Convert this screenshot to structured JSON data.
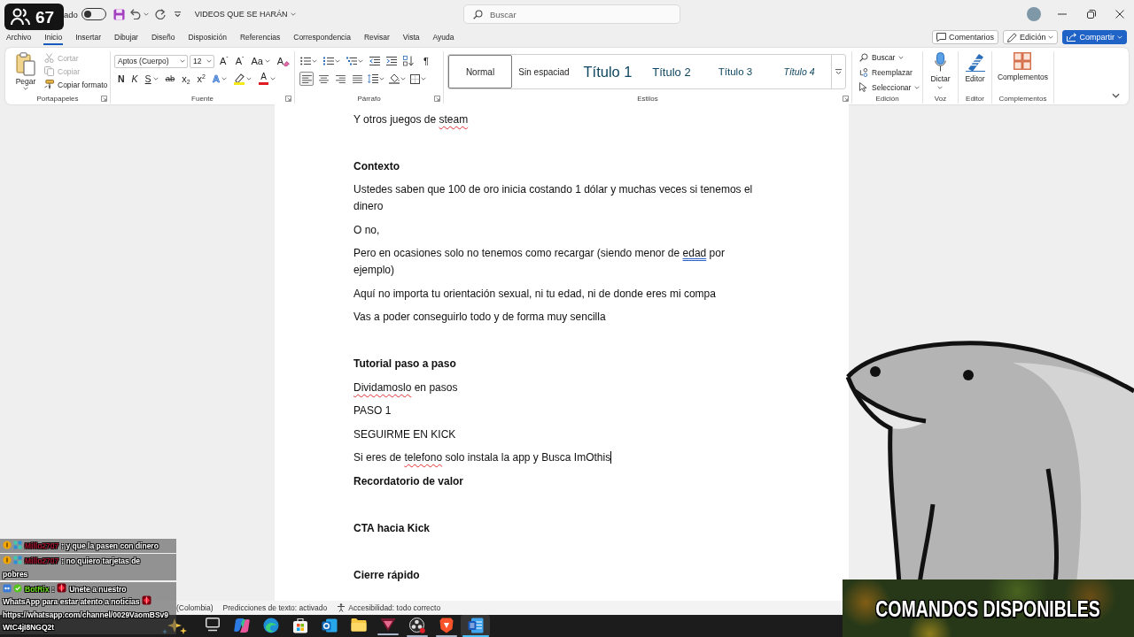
{
  "stream_overlay": {
    "viewer_count": "67"
  },
  "title_bar": {
    "autosave_label": "ado",
    "autosave_on": false,
    "document_title": "VIDEOS QUE SE HARÁN",
    "search": {
      "placeholder": "Buscar"
    }
  },
  "menu_tabs": [
    {
      "label": "Archivo",
      "selected": false
    },
    {
      "label": "Inicio",
      "selected": true
    },
    {
      "label": "Insertar",
      "selected": false
    },
    {
      "label": "Dibujar",
      "selected": false
    },
    {
      "label": "Diseño",
      "selected": false
    },
    {
      "label": "Disposición",
      "selected": false
    },
    {
      "label": "Referencias",
      "selected": false
    },
    {
      "label": "Correspondencia",
      "selected": false
    },
    {
      "label": "Revisar",
      "selected": false
    },
    {
      "label": "Vista",
      "selected": false
    },
    {
      "label": "Ayuda",
      "selected": false
    }
  ],
  "header_buttons": [
    {
      "kind": "comments",
      "label": "Comentarios"
    },
    {
      "kind": "mode",
      "label": "Edición"
    },
    {
      "kind": "share",
      "label": "Compartir"
    }
  ],
  "ribbon": {
    "clipboard": {
      "label": "Portapapeles",
      "paste": "Pegar",
      "items": [
        {
          "kind": "cut",
          "label": "Cortar",
          "disabled": true
        },
        {
          "kind": "copy",
          "label": "Copiar",
          "disabled": true
        },
        {
          "kind": "format_painter",
          "label": "Copiar formato",
          "disabled": false
        }
      ]
    },
    "font": {
      "label": "Fuente",
      "font_name": "Aptos (Cuerpo)",
      "font_size": "12",
      "row_1": [
        {
          "kind": "grow",
          "label": "A$^{ˆ}$"
        },
        {
          "kind": "shrink",
          "label": "A$^{ˇ}$"
        },
        {
          "kind": "case",
          "label": "Aa"
        },
        {
          "kind": "clear",
          "label": "A"
        }
      ],
      "row_2": [
        {
          "kind": "bold",
          "label": "N"
        },
        {
          "kind": "italic",
          "label": "K"
        },
        {
          "kind": "underline",
          "label": "S"
        },
        {
          "kind": "strike",
          "label": "ab"
        },
        {
          "kind": "subscript",
          "label": "x$_{2}$"
        },
        {
          "kind": "superscript",
          "label": "x$^{2}$"
        },
        {
          "kind": "effects",
          "label": "A"
        },
        {
          "kind": "highlight"
        },
        {
          "kind": "color",
          "label": "A"
        }
      ]
    },
    "paragraph": {
      "label": "Párrafo",
      "marks": "¶",
      "alignment": [
        {
          "selected": true
        },
        {
          "selected": false
        },
        {
          "selected": false
        },
        {
          "selected": false
        }
      ]
    },
    "styles": {
      "label": "Estilos",
      "items": [
        {
          "kind": "body",
          "label": "Normal",
          "selected": true
        },
        {
          "kind": "body",
          "label": "Sin espaciad",
          "selected": false
        },
        {
          "kind": "heading_1",
          "label": "Título 1",
          "selected": false
        },
        {
          "kind": "heading_2",
          "label": "Título 2",
          "selected": false
        },
        {
          "kind": "heading_3",
          "label": "Título 3",
          "selected": false
        },
        {
          "kind": "heading_4",
          "label": "Título 4",
          "selected": false
        }
      ]
    },
    "editing": {
      "label": "Edición",
      "items": [
        {
          "kind": "find",
          "label": "Buscar"
        },
        {
          "kind": "replace",
          "label": "Reemplazar"
        },
        {
          "kind": "select",
          "label": "Seleccionar"
        }
      ]
    },
    "voice": {
      "label": "Voz",
      "button": "Dictar"
    },
    "editor": {
      "label": "Editor",
      "button": "Editor"
    },
    "addins": {
      "label": "Complementos",
      "button": "Complementos"
    }
  },
  "document": {
    "paragraphs": [
      {
        "kind": "body",
        "cursor": false,
        "runs": [
          {
            "kind": "plain",
            "text": "Y otros juegos de "
          },
          {
            "kind": "spelling",
            "text": "steam"
          }
        ]
      },
      {
        "kind": "blank"
      },
      {
        "kind": "heading",
        "cursor": false,
        "runs": [
          {
            "kind": "plain",
            "text": "Contexto"
          }
        ]
      },
      {
        "kind": "body",
        "cursor": false,
        "runs": [
          {
            "kind": "plain",
            "text": "Ustedes saben que 100 de oro inicia costando 1 dólar y muchas veces si tenemos el dinero"
          }
        ]
      },
      {
        "kind": "body",
        "cursor": false,
        "runs": [
          {
            "kind": "plain",
            "text": "O no,"
          }
        ]
      },
      {
        "kind": "body",
        "cursor": false,
        "runs": [
          {
            "kind": "plain",
            "text": "Pero en ocasiones solo no tenemos como recargar (siendo menor de "
          },
          {
            "kind": "grammar",
            "text": "edad"
          },
          {
            "kind": "plain",
            "text": " por ejemplo)"
          }
        ]
      },
      {
        "kind": "body",
        "cursor": false,
        "runs": [
          {
            "kind": "plain",
            "text": "Aquí no importa tu orientación sexual, ni tu edad, ni de donde eres mi compa"
          }
        ]
      },
      {
        "kind": "body",
        "cursor": false,
        "runs": [
          {
            "kind": "plain",
            "text": "Vas a poder conseguirlo todo y de forma muy sencilla"
          }
        ]
      },
      {
        "kind": "blank"
      },
      {
        "kind": "heading",
        "cursor": false,
        "runs": [
          {
            "kind": "plain",
            "text": "Tutorial paso a paso"
          }
        ]
      },
      {
        "kind": "body",
        "cursor": false,
        "runs": [
          {
            "kind": "spelling",
            "text": "Dividamoslo"
          },
          {
            "kind": "plain",
            "text": " en pasos"
          }
        ]
      },
      {
        "kind": "body",
        "cursor": false,
        "runs": [
          {
            "kind": "plain",
            "text": "PASO 1"
          }
        ]
      },
      {
        "kind": "body",
        "cursor": false,
        "runs": [
          {
            "kind": "plain",
            "text": "SEGUIRME EN KICK"
          }
        ]
      },
      {
        "kind": "body",
        "cursor": true,
        "runs": [
          {
            "kind": "plain",
            "text": "Si eres de "
          },
          {
            "kind": "spelling",
            "text": "telefono"
          },
          {
            "kind": "plain",
            "text": " solo instala la app y Busca ImOthis"
          }
        ]
      },
      {
        "kind": "heading",
        "cursor": false,
        "runs": [
          {
            "kind": "plain",
            "text": "Recordatorio de valor"
          }
        ]
      },
      {
        "kind": "blank"
      },
      {
        "kind": "heading",
        "cursor": false,
        "runs": [
          {
            "kind": "plain",
            "text": "CTA hacia Kick"
          }
        ]
      },
      {
        "kind": "blank"
      },
      {
        "kind": "heading",
        "cursor": false,
        "runs": [
          {
            "kind": "plain",
            "text": "Cierre rápido"
          }
        ]
      }
    ]
  },
  "status_bar": {
    "items": [
      {
        "kind": "text",
        "label": "(Colombia)"
      },
      {
        "kind": "text",
        "label": "Predicciones de texto: activado"
      },
      {
        "kind": "accessibility",
        "label": "Accesibilidad: todo correcto"
      }
    ]
  },
  "chat": {
    "messages": [
      {
        "kind": "viewer",
        "user": "Millo2707",
        "color": "#a8102c",
        "parts": [
          {
            "kind": "text",
            "text": ": y que la pasen con dinero"
          }
        ]
      },
      {
        "kind": "viewer",
        "user": "Millo2707",
        "color": "#a8102c",
        "parts": [
          {
            "kind": "text",
            "text": ": no quiero tarjetas de"
          },
          {
            "kind": "line",
            "text": "pobres"
          }
        ]
      },
      {
        "kind": "bot",
        "user": "BotRix",
        "color": "#6ee01c",
        "parts": [
          {
            "kind": "text",
            "text": ":"
          },
          {
            "kind": "emote"
          },
          {
            "kind": "text",
            "text": "Unete a nuestro"
          },
          {
            "kind": "line",
            "text": "WhatsApp para estar atento a noticias"
          },
          {
            "kind": "emote"
          },
          {
            "kind": "link",
            "text": "https://whatsapp.com/channel/0029VaomBSv9WtC4jI8NGQ2t"
          }
        ]
      }
    ]
  },
  "commands_panel": {
    "title": "COMANDOS DISPONIBLES"
  },
  "taskbar": {
    "apps": [
      {
        "running": false,
        "selected": false
      },
      {
        "running": false,
        "selected": false
      },
      {
        "running": false,
        "selected": false
      },
      {
        "running": false,
        "selected": false
      },
      {
        "running": false,
        "selected": false
      },
      {
        "running": false,
        "selected": false
      },
      {
        "running": true,
        "selected": false
      },
      {
        "running": true,
        "selected": false
      },
      {
        "running": true,
        "selected": false
      },
      {
        "running": true,
        "selected": true
      }
    ]
  }
}
